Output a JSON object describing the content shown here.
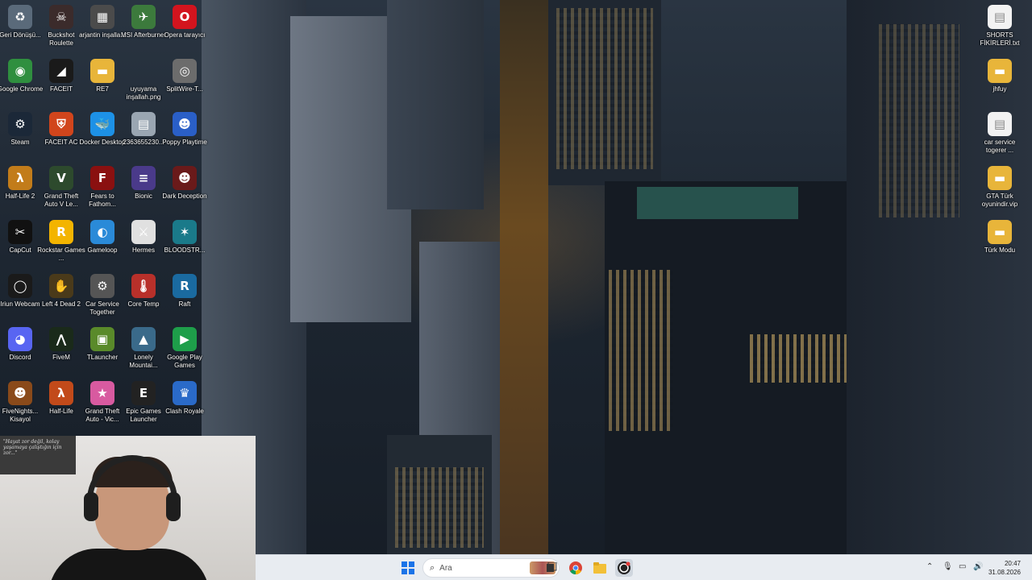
{
  "desktop": {
    "left_icons": [
      {
        "id": "recycle",
        "label": "Geri Dönüşü...",
        "icon": "recycle-bin-icon",
        "glyph": "♻",
        "color": "#5a6a7a"
      },
      {
        "id": "buckshot",
        "label": "Buckshot Roulette",
        "icon": "buckshot-roulette-icon",
        "glyph": "☠",
        "color": "#3b2b2b"
      },
      {
        "id": "arjantin",
        "label": "arjantin inşalla...",
        "icon": "image-file-icon",
        "glyph": "▦",
        "color": "#4b4b4b"
      },
      {
        "id": "msi",
        "label": "MSI Afterburner",
        "icon": "msi-afterburner-icon",
        "glyph": "✈",
        "color": "#3c7a3c"
      },
      {
        "id": "opera",
        "label": "Opera tarayıcı",
        "icon": "opera-icon",
        "glyph": "O",
        "color": "#d3141e"
      },
      {
        "id": "chrome",
        "label": "Google Chrome",
        "icon": "chrome-icon",
        "glyph": "◉",
        "color": "#2f8f3f"
      },
      {
        "id": "faceit",
        "label": "FACEIT",
        "icon": "faceit-icon",
        "glyph": "◢",
        "color": "#1a1a1a"
      },
      {
        "id": "re7",
        "label": "RE7",
        "icon": "folder-icon",
        "glyph": "▬",
        "color": "#e8b53a"
      },
      {
        "id": "uyuyama",
        "label": "uyuyama inşallah.png",
        "icon": "image-file-icon",
        "glyph": "",
        "color": "transparent"
      },
      {
        "id": "splitwire",
        "label": "SplitWire-T...",
        "icon": "splitwire-icon",
        "glyph": "◎",
        "color": "#6c6c6c"
      },
      {
        "id": "steam",
        "label": "Steam",
        "icon": "steam-icon",
        "glyph": "⚙",
        "color": "#1b2838"
      },
      {
        "id": "faceitac",
        "label": "FACEIT AC",
        "icon": "faceit-ac-icon",
        "glyph": "⛨",
        "color": "#d1451c"
      },
      {
        "id": "docker",
        "label": "Docker Desktop",
        "icon": "docker-icon",
        "glyph": "🐳",
        "color": "#1d91e6"
      },
      {
        "id": "num",
        "label": "2363655230...",
        "icon": "image-file-icon",
        "glyph": "▤",
        "color": "#9aa6b2"
      },
      {
        "id": "poppy",
        "label": "Poppy Playtime",
        "icon": "poppy-playtime-icon",
        "glyph": "☻",
        "color": "#2a5fc7"
      },
      {
        "id": "hl2",
        "label": "Half-Life 2",
        "icon": "half-life-2-icon",
        "glyph": "λ",
        "color": "#c27c1a"
      },
      {
        "id": "gta5",
        "label": "Grand Theft Auto V Le...",
        "icon": "gta-v-icon",
        "glyph": "V",
        "color": "#2d4a2d"
      },
      {
        "id": "f2f",
        "label": "Fears to Fathom...",
        "icon": "fears-to-fathom-icon",
        "glyph": "F",
        "color": "#8a1010"
      },
      {
        "id": "bionic",
        "label": "Bionic",
        "icon": "bionic-icon",
        "glyph": "≡",
        "color": "#4a3a8a"
      },
      {
        "id": "dark",
        "label": "Dark Deception",
        "icon": "dark-deception-icon",
        "glyph": "☻",
        "color": "#6a1a1a"
      },
      {
        "id": "capcut",
        "label": "CapCut",
        "icon": "capcut-icon",
        "glyph": "✂",
        "color": "#111111"
      },
      {
        "id": "rockstar",
        "label": "Rockstar Games ...",
        "icon": "rockstar-icon",
        "glyph": "R",
        "color": "#f3b400"
      },
      {
        "id": "gameloop",
        "label": "Gameloop",
        "icon": "gameloop-icon",
        "glyph": "◐",
        "color": "#2a8ad8"
      },
      {
        "id": "hermes",
        "label": "Hermes",
        "icon": "hermes-icon",
        "glyph": "⚔",
        "color": "#e0e0e0"
      },
      {
        "id": "blood",
        "label": "BLOODSTR...",
        "icon": "bloodstrike-icon",
        "glyph": "✶",
        "color": "#1a7a8a"
      },
      {
        "id": "iriun",
        "label": "Iriun Webcam",
        "icon": "iriun-webcam-icon",
        "glyph": "◯",
        "color": "#1a1a1a"
      },
      {
        "id": "l4d2",
        "label": "Left 4 Dead 2",
        "icon": "left-4-dead-2-icon",
        "glyph": "✋",
        "color": "#4a3a1a"
      },
      {
        "id": "carservice",
        "label": "Car Service Together",
        "icon": "car-service-icon",
        "glyph": "⚙",
        "color": "#555555"
      },
      {
        "id": "coretemp",
        "label": "Core Temp",
        "icon": "core-temp-icon",
        "glyph": "🌡",
        "color": "#b8302a"
      },
      {
        "id": "raft",
        "label": "Raft",
        "icon": "raft-icon",
        "glyph": "R",
        "color": "#1a6aa0"
      },
      {
        "id": "discord",
        "label": "Discord",
        "icon": "discord-icon",
        "glyph": "◕",
        "color": "#5865f2"
      },
      {
        "id": "fivem",
        "label": "FiveM",
        "icon": "fivem-icon",
        "glyph": "⋀",
        "color": "#1a2a1a"
      },
      {
        "id": "tlauncher",
        "label": "TLauncher",
        "icon": "tlauncher-icon",
        "glyph": "▣",
        "color": "#5a8a2a"
      },
      {
        "id": "lonely",
        "label": "Lonely Mountai...",
        "icon": "lonely-mountains-icon",
        "glyph": "▲",
        "color": "#3a6a8a"
      },
      {
        "id": "gpg",
        "label": "Google Play Games",
        "icon": "google-play-games-icon",
        "glyph": "▶",
        "color": "#1e9e4a"
      },
      {
        "id": "fnaf",
        "label": "FiveNights... Kisayol",
        "icon": "fnaf-icon",
        "glyph": "☻",
        "color": "#8a4a1a"
      },
      {
        "id": "hl",
        "label": "Half-Life",
        "icon": "half-life-icon",
        "glyph": "λ",
        "color": "#c24a1a"
      },
      {
        "id": "gtavc",
        "label": "Grand Theft Auto - Vic...",
        "icon": "gta-vice-city-icon",
        "glyph": "★",
        "color": "#d85aa0"
      },
      {
        "id": "epic",
        "label": "Epic Games Launcher",
        "icon": "epic-games-icon",
        "glyph": "E",
        "color": "#222222"
      },
      {
        "id": "clash",
        "label": "Clash Royale",
        "icon": "clash-royale-icon",
        "glyph": "♛",
        "color": "#2a6ac8"
      }
    ],
    "right_icons": [
      {
        "id": "shorts",
        "label": "SHORTS FİKİRLERİ.txt",
        "icon": "text-file-icon",
        "glyph": "▤",
        "color": "#f2f2f2"
      },
      {
        "id": "jhfuy",
        "label": "jhfuy",
        "icon": "folder-icon",
        "glyph": "▬",
        "color": "#e8b53a"
      },
      {
        "id": "carservicetxt",
        "label": "car service togerer ...",
        "icon": "text-file-icon",
        "glyph": "▤",
        "color": "#f2f2f2"
      },
      {
        "id": "gtaturk",
        "label": "GTA Türk oyunindir.vip",
        "icon": "folder-icon",
        "glyph": "▬",
        "color": "#e8b53a"
      },
      {
        "id": "turkmodu",
        "label": "Türk Modu",
        "icon": "folder-icon",
        "glyph": "▬",
        "color": "#e8b53a"
      }
    ]
  },
  "webcam": {
    "poster_text": "\"Hayat zor değil, kolay yaşamaya çalıştığın için zor...\""
  },
  "taskbar": {
    "search_placeholder": "Ara",
    "clock_time": "20:47",
    "clock_date": "31.08.2026"
  }
}
